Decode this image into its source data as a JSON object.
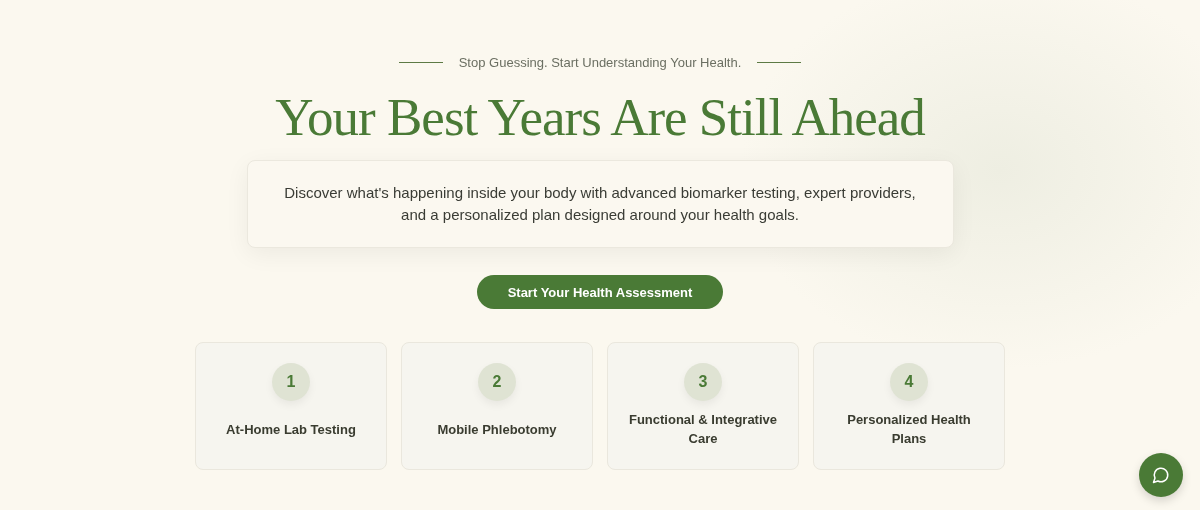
{
  "tagline": "Stop Guessing. Start Understanding Your Health.",
  "title": "Your Best Years Are Still Ahead",
  "description": "Discover what's happening inside your body with advanced biomarker testing, expert providers, and a personalized plan designed around your health goals.",
  "cta": "Start Your Health Assessment",
  "services": [
    {
      "number": "1",
      "label": "At-Home Lab Testing"
    },
    {
      "number": "2",
      "label": "Mobile Phlebotomy"
    },
    {
      "number": "3",
      "label": "Functional & Integrative Care"
    },
    {
      "number": "4",
      "label": "Personalized Health Plans"
    }
  ]
}
